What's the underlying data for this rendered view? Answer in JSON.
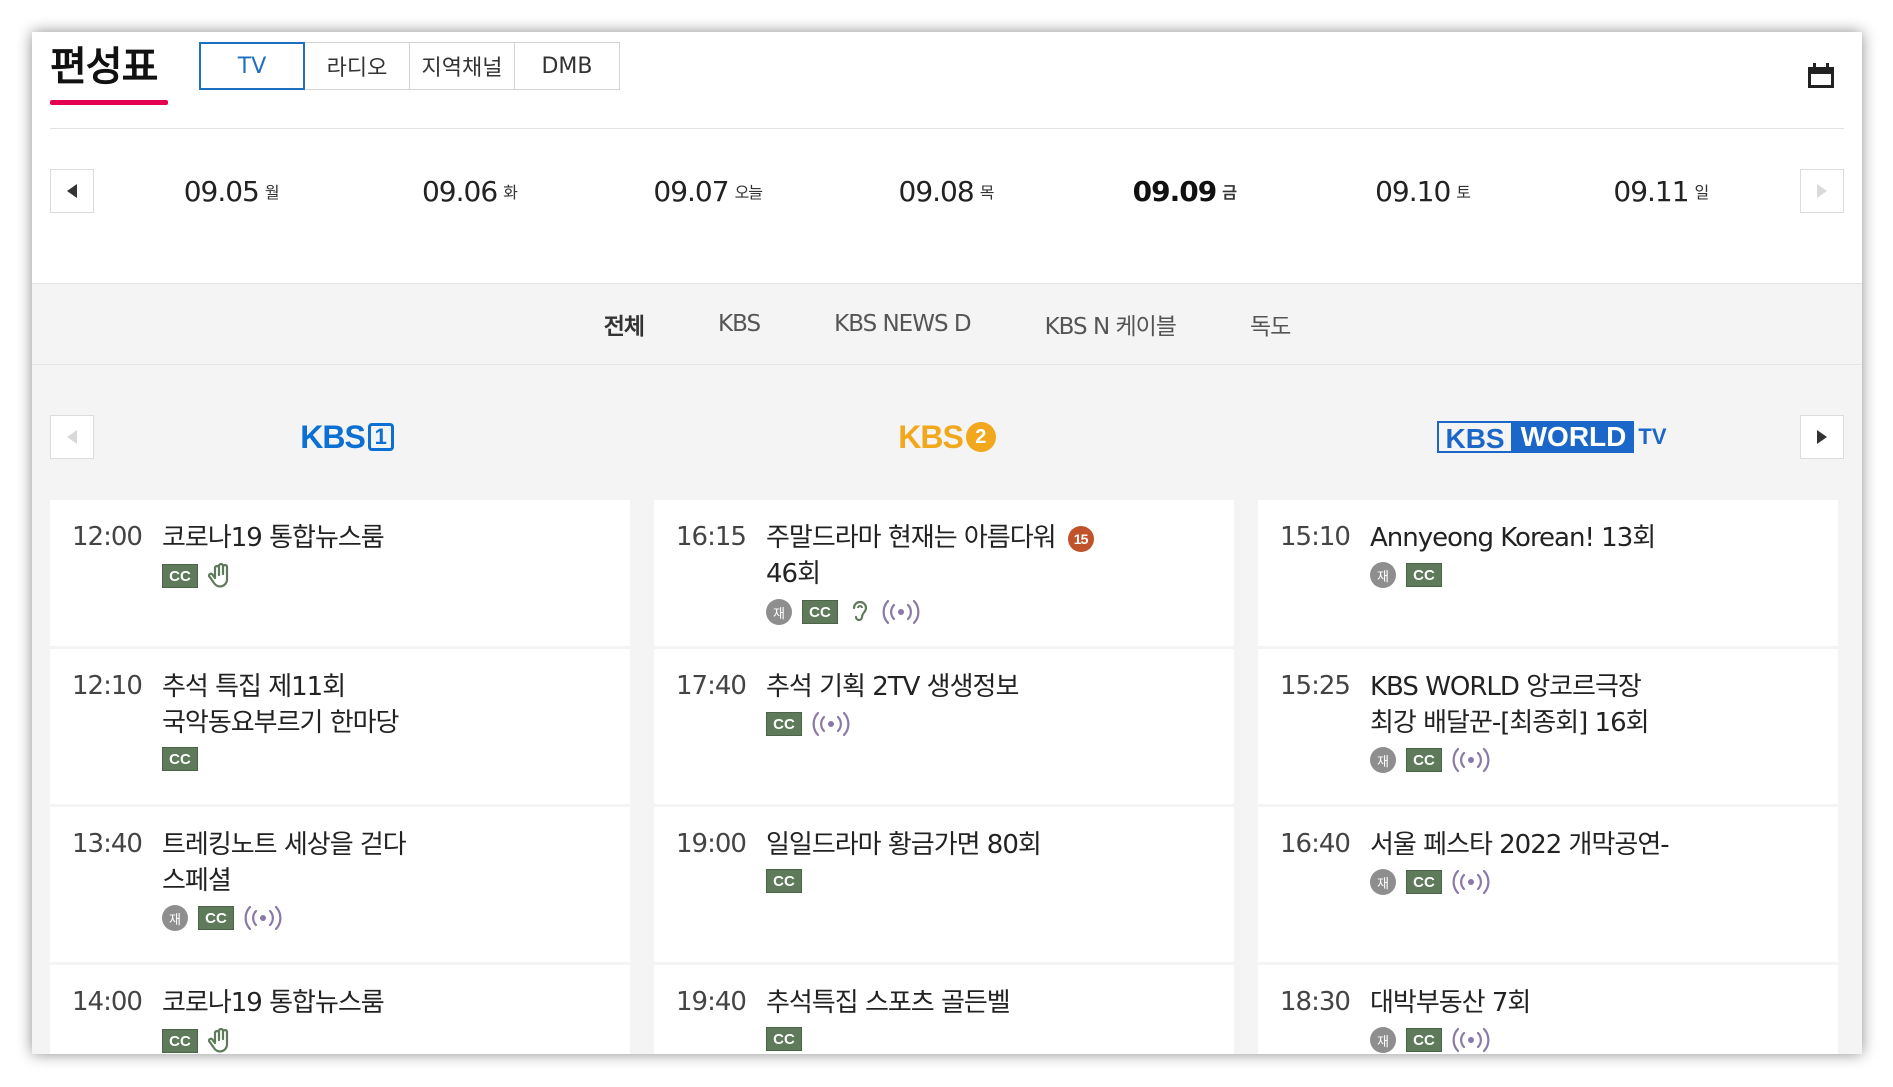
{
  "header": {
    "title": "편성표",
    "tabs": [
      {
        "label": "TV",
        "active": true
      },
      {
        "label": "라디오",
        "active": false
      },
      {
        "label": "지역채널",
        "active": false
      },
      {
        "label": "DMB",
        "active": false
      }
    ],
    "calendar_icon": "calendar-icon"
  },
  "dates": [
    {
      "date": "09.05",
      "dow": "월"
    },
    {
      "date": "09.06",
      "dow": "화"
    },
    {
      "date": "09.07",
      "dow": "오늘"
    },
    {
      "date": "09.08",
      "dow": "목"
    },
    {
      "date": "09.09",
      "dow": "금",
      "selected": true
    },
    {
      "date": "09.10",
      "dow": "토"
    },
    {
      "date": "09.11",
      "dow": "일"
    }
  ],
  "filters": [
    {
      "label": "전체",
      "active": true
    },
    {
      "label": "KBS"
    },
    {
      "label": "KBS NEWS D"
    },
    {
      "label": "KBS N 케이블"
    },
    {
      "label": "독도"
    }
  ],
  "channels": {
    "kbs1": {
      "logo_a": "KBS",
      "logo_b": "1",
      "color": "#0b6fd4"
    },
    "kbs2": {
      "logo_a": "KBS",
      "logo_b": "2",
      "color": "#f2a81d"
    },
    "world": {
      "logo_a": "KBS",
      "logo_b": "WORLD",
      "logo_c": "TV",
      "color": "#1b67c9"
    }
  },
  "icons": {
    "cc": "CC",
    "rerun": "재",
    "age15": "15"
  },
  "schedule": {
    "kbs1": [
      {
        "time": "12:00",
        "title": "코로나19 통합뉴스룸"
      },
      {
        "time": "12:10",
        "title": "추석 특집 제11회",
        "title2": "국악동요부르기 한마당"
      },
      {
        "time": "13:40",
        "title": "트레킹노트 세상을 걷다",
        "title2": "스페셜"
      },
      {
        "time": "14:00",
        "title": "코로나19 통합뉴스룸"
      }
    ],
    "kbs2": [
      {
        "time": "16:15",
        "title": "주말드라마 현재는 아름다워",
        "title2": "46회"
      },
      {
        "time": "17:40",
        "title": "추석 기획 2TV 생생정보"
      },
      {
        "time": "19:00",
        "title": "일일드라마 황금가면 80회"
      },
      {
        "time": "19:40",
        "title": "추석특집 스포츠 골든벨"
      }
    ],
    "world": [
      {
        "time": "15:10",
        "title": "Annyeong Korean! 13회"
      },
      {
        "time": "15:25",
        "title": "KBS WORLD 앙코르극장",
        "title2": "최강 배달꾼-[최종회] 16회"
      },
      {
        "time": "16:40",
        "title": "서울 페스타 2022 개막공연-"
      },
      {
        "time": "18:30",
        "title": "대박부동산 7회"
      }
    ]
  }
}
